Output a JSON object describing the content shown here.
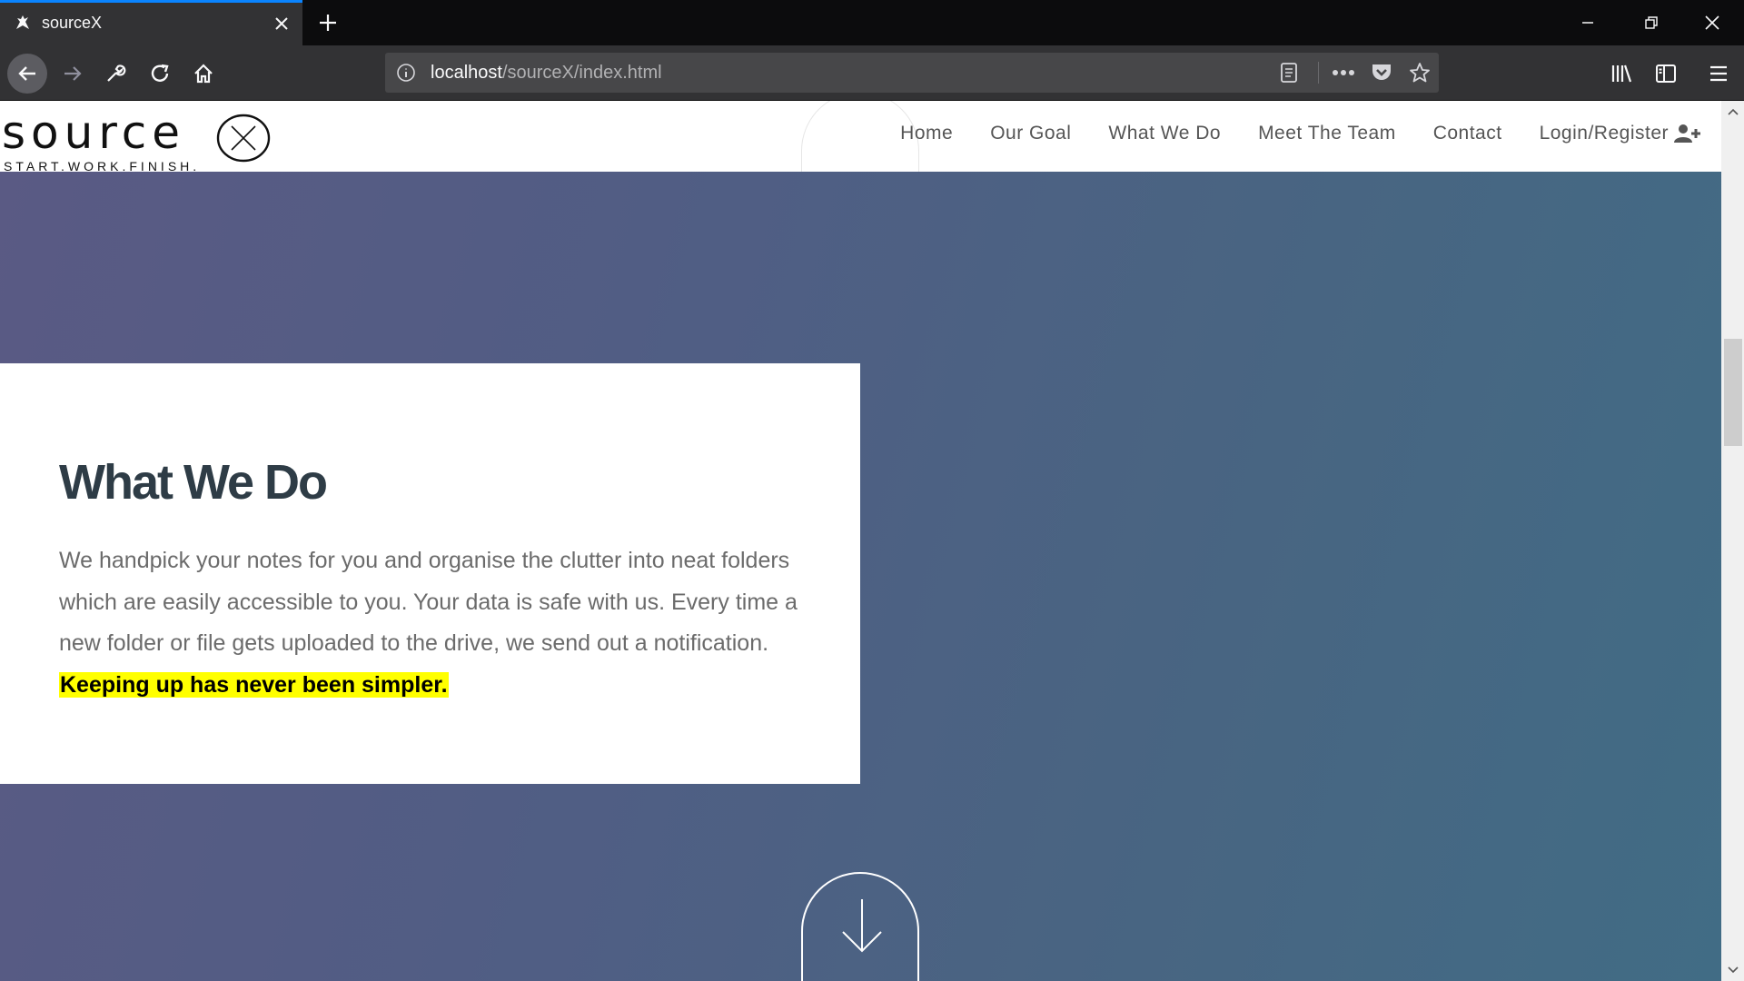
{
  "browser": {
    "tab_title": "sourceX",
    "favicon": "bird-icon",
    "url_host": "localhost",
    "url_path": "/sourceX/index.html"
  },
  "site": {
    "logo_word": "source",
    "logo_tagline": "START.WORK.FINISH.",
    "menu": [
      {
        "label": "Home"
      },
      {
        "label": "Our Goal"
      },
      {
        "label": "What We Do"
      },
      {
        "label": "Meet The Team"
      },
      {
        "label": "Contact"
      },
      {
        "label": "Login/Register",
        "icon": "user-plus-icon"
      }
    ]
  },
  "section": {
    "title": "What We Do",
    "body": "We handpick your notes for you and organise the clutter into neat folders which are easily accessible to you. Your data is safe with us. Every time a new folder or file gets uploaded to the drive, we send out a notification.",
    "highlight": "Keeping up has never been simpler."
  },
  "colors": {
    "gradient_start": "#5a5a84",
    "gradient_end": "#416c85",
    "title": "#2e3c46",
    "highlight": "#ffff00",
    "tab_accent": "#0a84ff"
  }
}
